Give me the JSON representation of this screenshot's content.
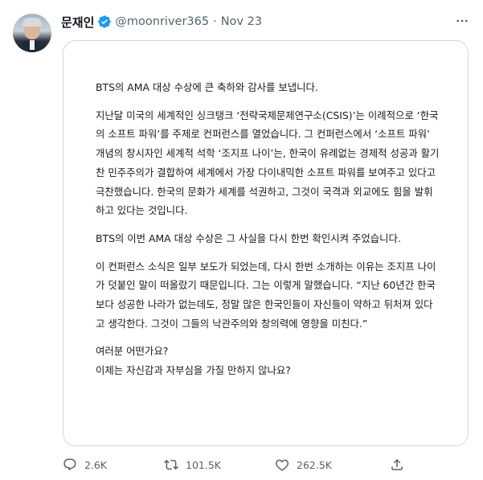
{
  "author": {
    "display_name": "문재인",
    "handle": "@moonriver365",
    "separator": "·",
    "date": "Nov 23"
  },
  "image_text": {
    "p1": "BTS의 AMA 대상 수상에 큰 축하와 감사를 보냅니다.",
    "p2": "지난달 미국의 세계적인 싱크탱크 ‘전략국제문제연구소(CSIS)’는 이례적으로 ‘한국의 소프트 파워’를 주제로 컨퍼런스를 열었습니다. 그 컨퍼런스에서 ‘소프트 파워’ 개념의 창시자인 세계적 석학 ‘조지프 나이’는, 한국이 유례없는 경제적 성공과 활기찬 민주주의가 결합하여 세계에서 가장 다이내믹한 소프트 파워를 보여주고 있다고 극찬했습니다. 한국의 문화가 세계를 석권하고, 그것이 국격과 외교에도 힘을 발휘하고 있다는 것입니다.",
    "p3": "BTS의 이번 AMA 대상 수상은 그 사실을 다시 한번 확인시켜 주었습니다.",
    "p4": "이 컨퍼런스 소식은 일부 보도가 되었는데, 다시 한번 소개하는 이유는 조지프 나이가 덧붙인 말이 떠올랐기 때문입니다. 그는 이렇게 말했습니다. “지난 60년간 한국보다 성공한 나라가 없는데도, 정말 많은 한국인들이 자신들이 약하고 뒤처져 있다고 생각한다. 그것이 그들의 낙관주의와 창의력에 영향을 미친다.”",
    "p5_line1": "여러분 어떤가요?",
    "p5_line2": "이제는 자신감과 자부심을 가질 만하지 않나요?"
  },
  "actions": {
    "reply_count": "2.6K",
    "retweet_count": "101.5K",
    "like_count": "262.5K"
  },
  "icons": {
    "verified": "verified-badge-icon",
    "more": "more-icon",
    "reply": "reply-icon",
    "retweet": "retweet-icon",
    "like": "like-icon",
    "share": "share-icon"
  },
  "colors": {
    "verified_blue": "#1d9bf0",
    "secondary_text": "#536471",
    "border": "#cfd9de"
  }
}
